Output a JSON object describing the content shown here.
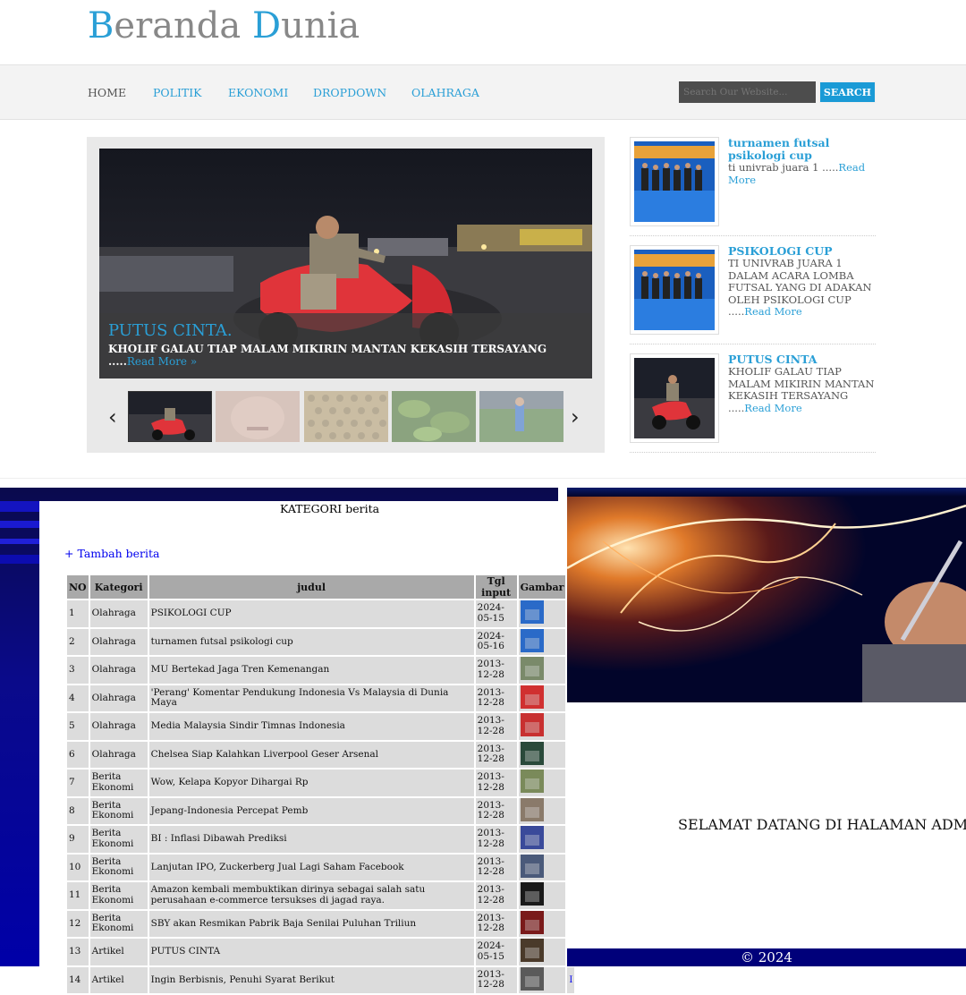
{
  "site": {
    "brand_part1": "Beranda",
    "brand_part2": "Dunia",
    "nav": [
      "HOME",
      "POLITIK",
      "EKONOMI",
      "DROPDOWN",
      "OLAHRAGA"
    ],
    "search_placeholder": "Search Our Website...",
    "search_button": "SEARCH",
    "slider": {
      "title": "PUTUS CINTA.",
      "text": "KHOLIF GALAU TIAP MALAM MIKIRIN MANTAN KEKASIH TERSAYANG .....",
      "read_more": "Read More »",
      "prev": "‹",
      "next": "›"
    },
    "side_posts": [
      {
        "title": "turnamen futsal psikologi cup",
        "text": "ti univrab juara 1 .....",
        "read_more": "Read More"
      },
      {
        "title": "PSIKOLOGI CUP",
        "text": "TI UNIVRAB JUARA 1 DALAM ACARA LOMBA FUTSAL YANG DI ADAKAN OLEH PSIKOLOGI CUP .....",
        "read_more": "Read More"
      },
      {
        "title": "PUTUS CINTA",
        "text": "KHOLIF GALAU TIAP MALAM MIKIRIN MANTAN KEKASIH TERSAYANG .....",
        "read_more": "Read More"
      }
    ]
  },
  "admin": {
    "title": "KATEGORI berita",
    "add_link": "+ Tambah berita",
    "headers": [
      "NO",
      "Kategori",
      "judul",
      "Tgl input",
      "Gambar",
      ""
    ],
    "rows": [
      {
        "no": "1",
        "kategori": "Olahraga",
        "judul": "PSIKOLOGI CUP",
        "tgl": "2024-05-15"
      },
      {
        "no": "2",
        "kategori": "Olahraga",
        "judul": "turnamen futsal psikologi cup",
        "tgl": "2024-05-16"
      },
      {
        "no": "3",
        "kategori": "Olahraga",
        "judul": "MU Bertekad Jaga Tren Kemenangan",
        "tgl": "2013-12-28"
      },
      {
        "no": "4",
        "kategori": "Olahraga",
        "judul": "'Perang' Komentar Pendukung Indonesia Vs Malaysia di Dunia Maya",
        "tgl": "2013-12-28"
      },
      {
        "no": "5",
        "kategori": "Olahraga",
        "judul": "Media Malaysia Sindir Timnas Indonesia",
        "tgl": "2013-12-28"
      },
      {
        "no": "6",
        "kategori": "Olahraga",
        "judul": "Chelsea Siap Kalahkan Liverpool Geser Arsenal",
        "tgl": "2013-12-28"
      },
      {
        "no": "7",
        "kategori": "Berita Ekonomi",
        "judul": "Wow, Kelapa Kopyor Dihargai Rp",
        "tgl": "2013-12-28"
      },
      {
        "no": "8",
        "kategori": "Berita Ekonomi",
        "judul": "Jepang-Indonesia Percepat Pemb",
        "tgl": "2013-12-28"
      },
      {
        "no": "9",
        "kategori": "Berita Ekonomi",
        "judul": "BI : Inflasi Dibawah Prediksi",
        "tgl": "2013-12-28"
      },
      {
        "no": "10",
        "kategori": "Berita Ekonomi",
        "judul": "Lanjutan IPO, Zuckerberg Jual Lagi Saham Facebook",
        "tgl": "2013-12-28"
      },
      {
        "no": "11",
        "kategori": "Berita Ekonomi",
        "judul": "Amazon kembali membuktikan dirinya sebagai salah satu perusahaan e-commerce tersukses di jagad raya.",
        "tgl": "2013-12-28"
      },
      {
        "no": "12",
        "kategori": "Berita Ekonomi",
        "judul": "SBY akan Resmikan Pabrik Baja Senilai Puluhan Triliun",
        "tgl": "2013-12-28"
      },
      {
        "no": "13",
        "kategori": "Artikel",
        "judul": "PUTUS CINTA",
        "tgl": "2024-05-15"
      },
      {
        "no": "14",
        "kategori": "Artikel",
        "judul": "Ingin Berbisnis, Penuhi Syarat Berikut",
        "tgl": "2013-12-28"
      }
    ],
    "welcome": "SELAMAT DATANG DI HALAMAN ADMI",
    "footer": "© 2024"
  },
  "colors": {
    "accent": "#2a9fd6",
    "admin_blue": "#0000a8",
    "nav_bg": "#f3f3f3"
  }
}
